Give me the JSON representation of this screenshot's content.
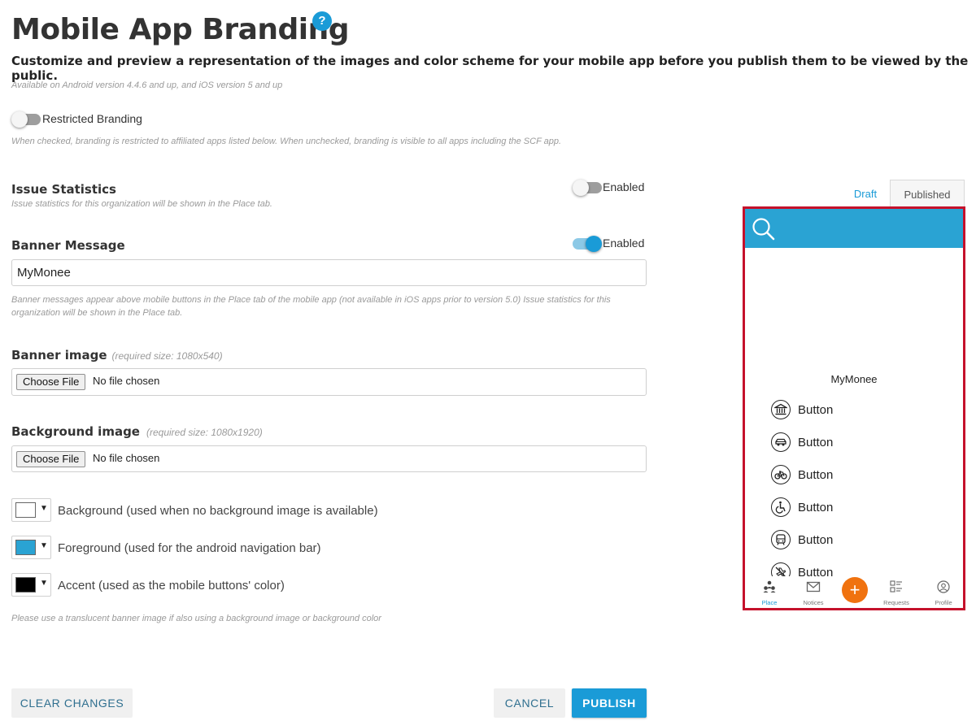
{
  "header": {
    "title": "Mobile App Branding",
    "help_glyph": "?",
    "subtitle": "Customize and preview a representation of the images and color scheme for your mobile app before you publish them to be viewed by the public.",
    "availability": "Available on Android version 4.4.6 and up, and iOS version 5 and up"
  },
  "restricted_branding": {
    "label": "Restricted Branding",
    "enabled": false,
    "note": "When checked, branding is restricted to affiliated apps listed below. When unchecked, branding is visible to all apps including the SCF app."
  },
  "issue_statistics": {
    "title": "Issue Statistics",
    "note": "Issue statistics for this organization will be shown in the Place tab.",
    "toggle_label": "Enabled",
    "enabled": false
  },
  "banner_message": {
    "title": "Banner Message",
    "toggle_label": "Enabled",
    "enabled": true,
    "value": "MyMonee",
    "note": "Banner messages appear above mobile buttons in the Place tab of the mobile app (not available in iOS apps prior to version 5.0) Issue statistics for this organization will be shown in the Place tab."
  },
  "banner_image": {
    "title": "Banner image",
    "required": "(required size: 1080x540)",
    "button": "Choose File",
    "status": "No file chosen"
  },
  "background_image": {
    "title": "Background image",
    "required": "(required size: 1080x1920)",
    "button": "Choose File",
    "status": "No file chosen"
  },
  "colors": {
    "arrow": "▼",
    "items": [
      {
        "label": "Background (used when no background image is available)",
        "color": "#ffffff"
      },
      {
        "label": "Foreground (used for the android navigation bar)",
        "color": "#2aa3d3"
      },
      {
        "label": "Accent (used as the mobile buttons' color)",
        "color": "#000000"
      }
    ],
    "note": "Please use a translucent banner image if also using a background image or background color"
  },
  "actions": {
    "clear": "CLEAR CHANGES",
    "cancel": "CANCEL",
    "publish": "PUBLISH"
  },
  "preview": {
    "tabs": {
      "draft": "Draft",
      "published": "Published",
      "selected": "Published"
    },
    "banner_text": "MyMonee",
    "buttons": [
      {
        "label": "Button",
        "icon": "bank-icon"
      },
      {
        "label": "Button",
        "icon": "car-icon"
      },
      {
        "label": "Button",
        "icon": "bicycle-icon"
      },
      {
        "label": "Button",
        "icon": "wheelchair-icon"
      },
      {
        "label": "Button",
        "icon": "bus-icon"
      },
      {
        "label": "Button",
        "icon": "no-plane-icon"
      }
    ],
    "nav": {
      "place": "Place",
      "notices": "Notices",
      "add": "+",
      "requests": "Requests",
      "profile": "Profile",
      "active": "Place"
    }
  }
}
